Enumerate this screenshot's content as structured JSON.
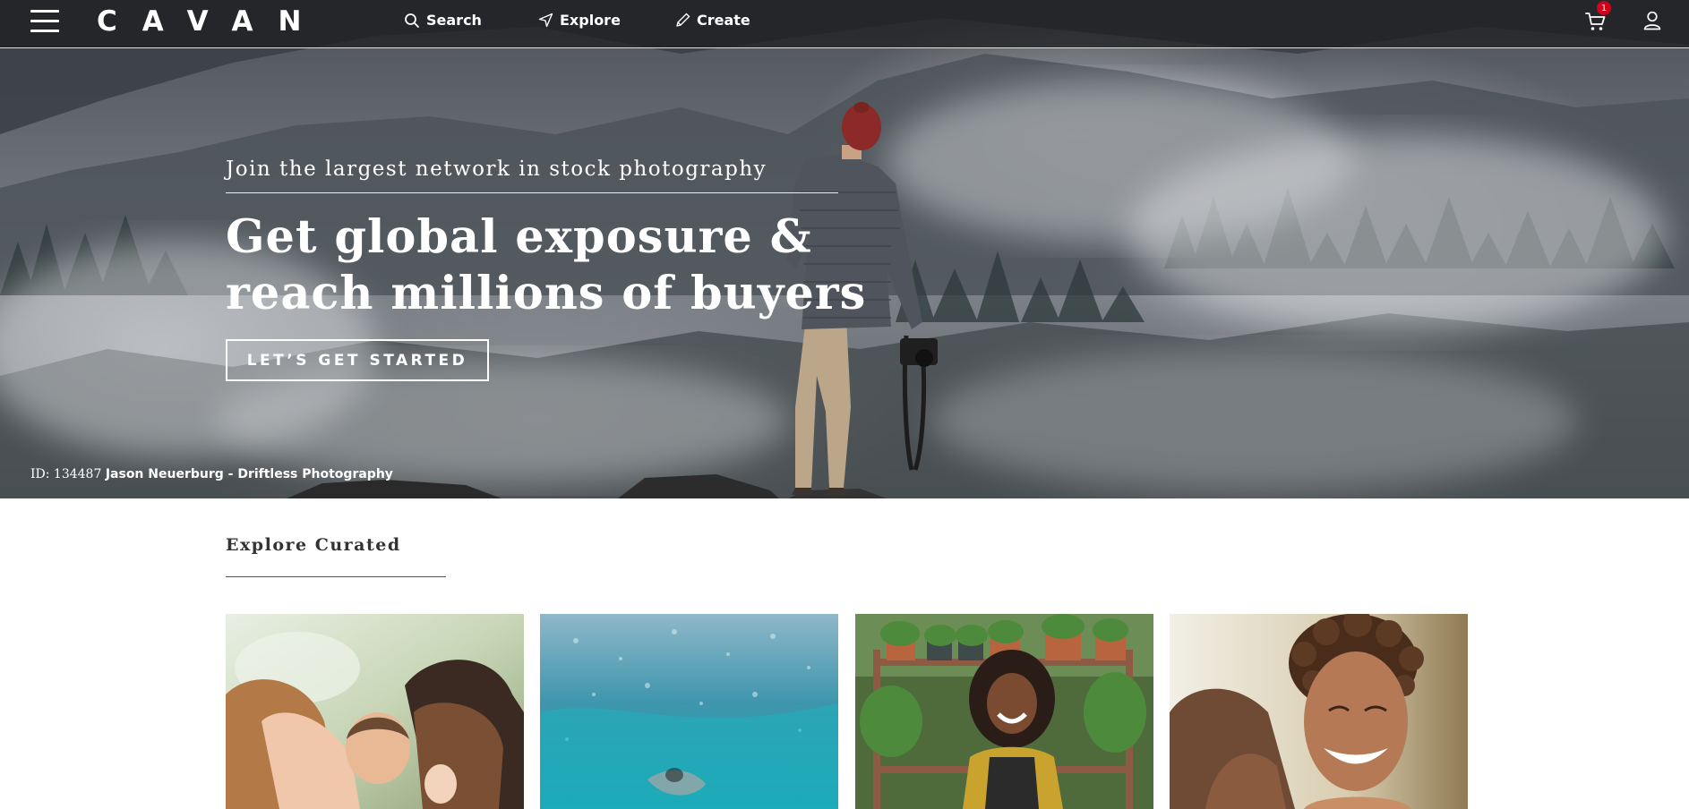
{
  "header": {
    "logo": "CAVAN",
    "nav": [
      {
        "label": "Search",
        "icon": "search-icon"
      },
      {
        "label": "Explore",
        "icon": "send-icon"
      },
      {
        "label": "Create",
        "icon": "pen-icon"
      }
    ],
    "cart_count": "1",
    "cart_icon": "cart-icon",
    "user_icon": "user-icon",
    "menu_icon": "hamburger-icon"
  },
  "hero": {
    "kicker": "Join the largest network in stock photography",
    "title": "Get global exposure & reach millions of buyers",
    "cta": "LET’S GET STARTED",
    "credit_id": "ID: 134487",
    "credit_author": "Jason Neuerburg - Driftless Photography"
  },
  "curated": {
    "title": "Explore Curated",
    "cards": [
      {
        "name": "family-kissing-baby-photo"
      },
      {
        "name": "underwater-swimmer-photo"
      },
      {
        "name": "smiling-florist-photo"
      },
      {
        "name": "laughing-man-photo"
      }
    ]
  },
  "colors": {
    "badge": "#d0021b",
    "nav_bg": "#1c1c1e",
    "section_text": "#333333"
  }
}
